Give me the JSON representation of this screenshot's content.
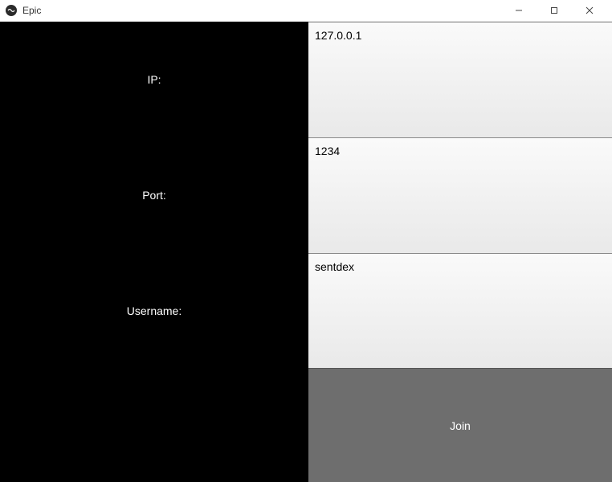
{
  "window": {
    "title": "Epic"
  },
  "form": {
    "ip_label": "IP:",
    "ip_value": "127.0.0.1",
    "port_label": "Port:",
    "port_value": "1234",
    "username_label": "Username:",
    "username_value": "sentdex",
    "join_button": "Join"
  }
}
